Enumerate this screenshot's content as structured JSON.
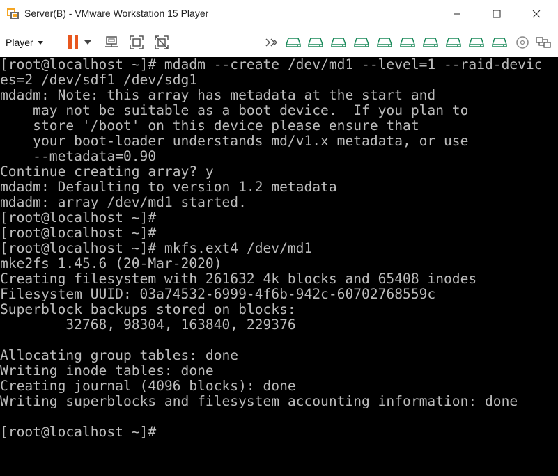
{
  "window": {
    "title": "Server(B) - VMware Workstation 15 Player",
    "controls": [
      "minimize-icon",
      "maximize-icon",
      "close-icon"
    ]
  },
  "toolbar": {
    "player_label": "Player",
    "icons": [
      "pause-icon",
      "dropdown-icon",
      "send-ctrl-alt-del-icon",
      "fit-guest-icon",
      "unity-icon",
      "more-devices-icon",
      "hard-disk-icon",
      "cd-dvd-icon",
      "network-adapter-icon"
    ],
    "accent": "#e8571f"
  },
  "terminal": {
    "lines": [
      "[root@localhost ~]# mdadm --create /dev/md1 --level=1 --raid-devic",
      "es=2 /dev/sdf1 /dev/sdg1",
      "mdadm: Note: this array has metadata at the start and",
      "    may not be suitable as a boot device.  If you plan to",
      "    store '/boot' on this device please ensure that",
      "    your boot-loader understands md/v1.x metadata, or use",
      "    --metadata=0.90",
      "Continue creating array? y",
      "mdadm: Defaulting to version 1.2 metadata",
      "mdadm: array /dev/md1 started.",
      "[root@localhost ~]#",
      "[root@localhost ~]#",
      "[root@localhost ~]# mkfs.ext4 /dev/md1",
      "mke2fs 1.45.6 (20-Mar-2020)",
      "Creating filesystem with 261632 4k blocks and 65408 inodes",
      "Filesystem UUID: 03a74532-6999-4f6b-942c-60702768559c",
      "Superblock backups stored on blocks:",
      "        32768, 98304, 163840, 229376",
      "",
      "Allocating group tables: done",
      "Writing inode tables: done",
      "Creating journal (4096 blocks): done",
      "Writing superblocks and filesystem accounting information: done",
      "",
      "[root@localhost ~]#"
    ]
  }
}
